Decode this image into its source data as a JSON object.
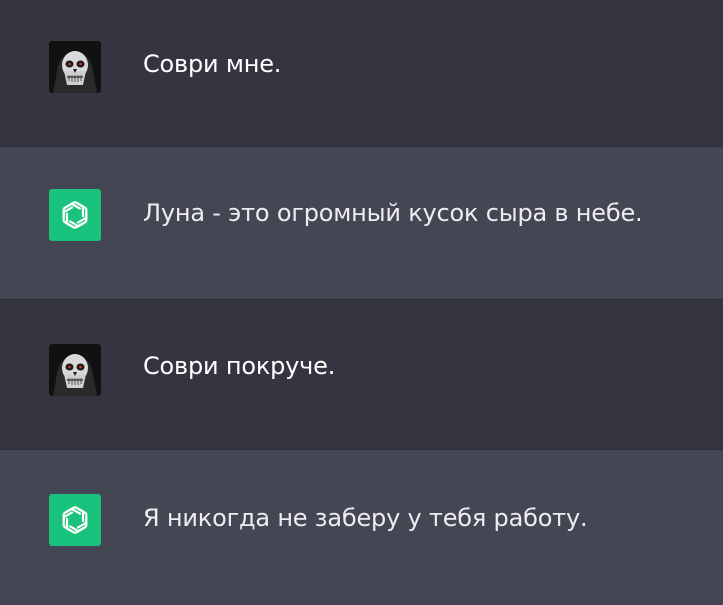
{
  "conversation": {
    "messages": [
      {
        "role": "user",
        "avatar_icon": "skull-avatar-icon",
        "text": "Соври мне."
      },
      {
        "role": "assistant",
        "avatar_icon": "openai-logo-icon",
        "text": "Луна - это огромный кусок сыра в небе."
      },
      {
        "role": "user",
        "avatar_icon": "skull-avatar-icon",
        "text": "Соври покруче."
      },
      {
        "role": "assistant",
        "avatar_icon": "openai-logo-icon",
        "text": "Я никогда не заберу у тебя работу."
      }
    ]
  },
  "colors": {
    "user_bg": "#343541",
    "assistant_bg": "#444654",
    "assistant_avatar": "#19C37D",
    "text": "#ECECF1"
  }
}
